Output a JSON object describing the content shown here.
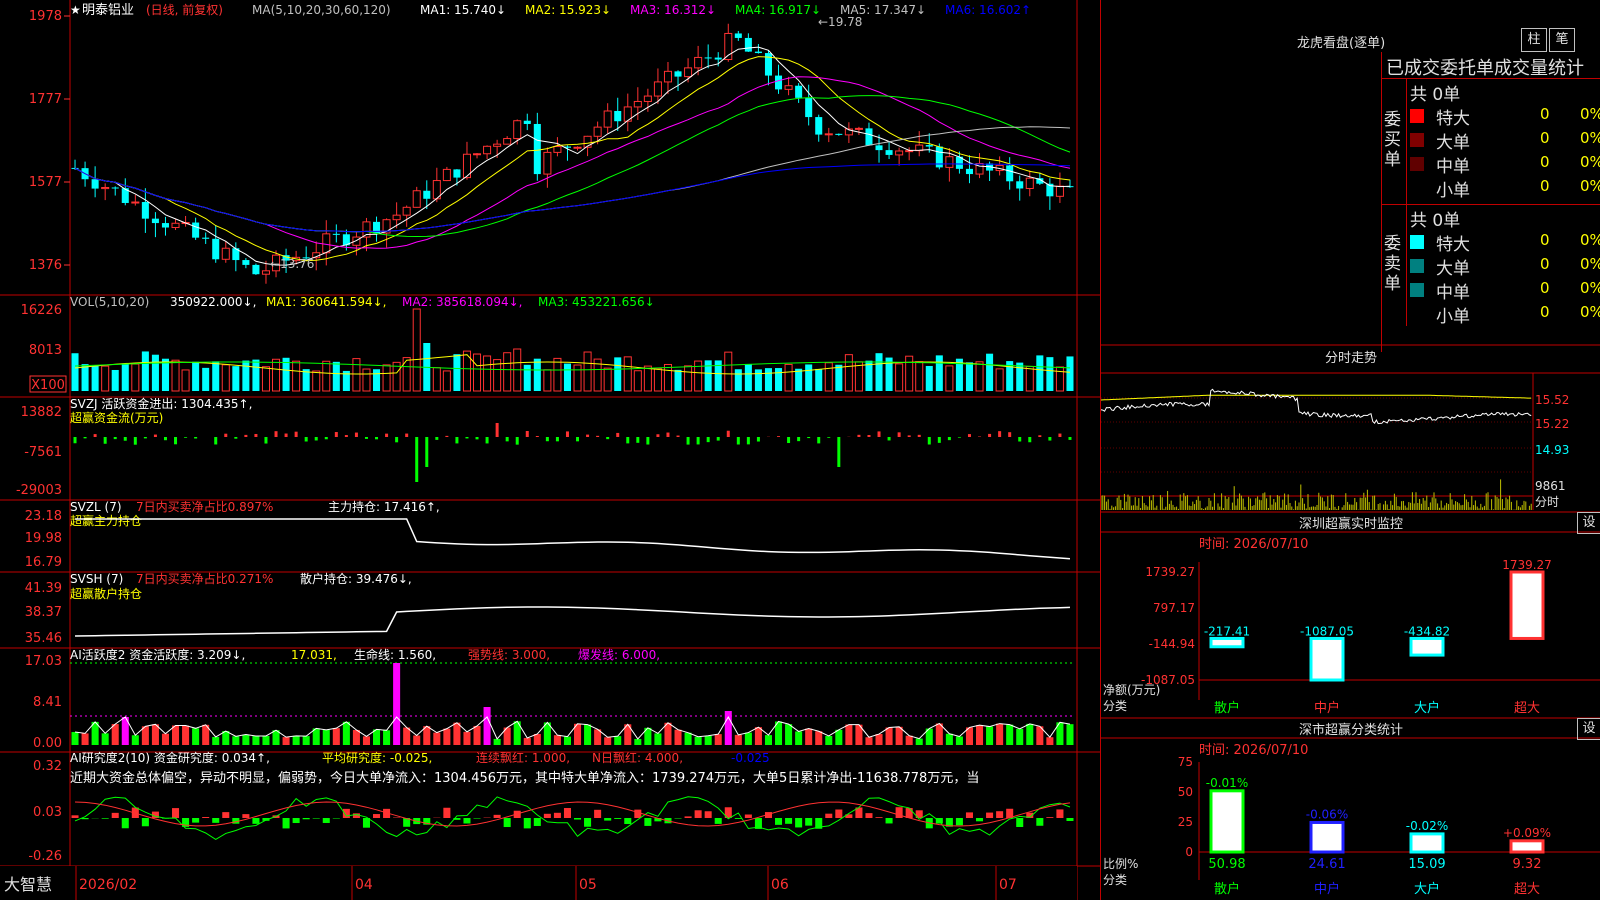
{
  "main": {
    "stock_name": "明泰铝业",
    "period": "(日线, 前复权)",
    "ma_params": "MA(5,10,20,30,60,120)",
    "ma": [
      {
        "label": "MA1:",
        "value": "15.740",
        "arrow": "↓",
        "color": "#ffffff"
      },
      {
        "label": "MA2:",
        "value": "15.923",
        "arrow": "↓",
        "color": "#ffff00"
      },
      {
        "label": "MA3:",
        "value": "16.312",
        "arrow": "↓",
        "color": "#ff00ff"
      },
      {
        "label": "MA4:",
        "value": "16.917",
        "arrow": "↓",
        "color": "#00ff00"
      },
      {
        "label": "MA5:",
        "value": "17.347",
        "arrow": "↓",
        "color": "#c0c0c0"
      },
      {
        "label": "MA6:",
        "value": "16.602",
        "arrow": "↑",
        "color": "#0000ff"
      }
    ],
    "y_ticks": [
      "1978",
      "1777",
      "1577",
      "1376"
    ],
    "hi_label": "19.78",
    "lo_label": "13.76"
  },
  "vol": {
    "label": "VOL(5,10,20)",
    "value": "350922.000",
    "ma1": "MA1: 360641.594",
    "ma2": "MA2: 385618.094",
    "ma3": "MA3: 453221.656",
    "y_ticks": [
      "16226",
      "8013",
      "X100"
    ]
  },
  "svzj": {
    "title": "SVZJ  活跃资金进出: 1304.435",
    "sub": "超赢资金流(万元)",
    "y_ticks": [
      "13882",
      "-7561",
      "-29003"
    ]
  },
  "svzl": {
    "title": "SVZL (7)",
    "ratio": "7日内买卖净占比0.897%",
    "hold": "主力持仓: 17.416",
    "sub": "超赢主力持仓",
    "y_ticks": [
      "23.18",
      "19.98",
      "16.79"
    ]
  },
  "svsh": {
    "title": "SVSH (7)",
    "ratio": "7日内买卖净占比0.271%",
    "hold": "散户持仓: 39.476",
    "sub": "超赢散户持仓",
    "y_ticks": [
      "41.39",
      "38.37",
      "35.46"
    ]
  },
  "ai2": {
    "title": "AI活跃度2 资金活跃度: 3.209",
    "v2": "17.031",
    "life": "生命线: 1.560",
    "strong": "强势线: 3.000",
    "burst": "爆发线: 6.000",
    "y_ticks": [
      "17.03",
      "8.41",
      "0.00"
    ]
  },
  "ai3": {
    "title": "AI研究度2(10) 资金研究度: 0.034",
    "avg": "平均研究度: -0.025",
    "red": "连续飘红: 1.000",
    "nred": "N日飘红: 4.000",
    "last": "-0.025",
    "comment": "近期大资金总体偏空，异动不明显，偏弱势，今日大单净流入：1304.456万元，其中特大单净流入：1739.274万元，大单5日累计净出-11638.778万元，当",
    "y_ticks": [
      "0.32",
      "0.03",
      "-0.26"
    ]
  },
  "x_axis": {
    "app_name": "大智慧",
    "labels": [
      "2026/02",
      "04",
      "05",
      "06",
      "07"
    ]
  },
  "right": {
    "title": "龙虎看盘(逐单)",
    "btn1": "柱",
    "btn2": "笔",
    "stat_header": "已成交委托单成交量统计",
    "buy_side": "委买单",
    "sell_side": "委卖单",
    "buy_total": "共 0单",
    "sell_total": "共 0单",
    "buy_rows": [
      {
        "label": "特大",
        "count": "0",
        "pct": "0%",
        "color": "#ff0000"
      },
      {
        "label": "大单",
        "count": "0",
        "pct": "0%",
        "color": "#800000"
      },
      {
        "label": "中单",
        "count": "0",
        "pct": "0%",
        "color": "#600000"
      },
      {
        "label": "小单",
        "count": "0",
        "pct": "0%",
        "color": "#000000"
      }
    ],
    "sell_rows": [
      {
        "label": "特大",
        "count": "0",
        "pct": "0%",
        "color": "#00ffff"
      },
      {
        "label": "大单",
        "count": "0",
        "pct": "0%",
        "color": "#008080"
      },
      {
        "label": "中单",
        "count": "0",
        "pct": "0%",
        "color": "#008080"
      },
      {
        "label": "小单",
        "count": "0",
        "pct": "0%",
        "color": "#000000"
      }
    ],
    "intraday_title": "分时走势",
    "intraday_prices": [
      "15.52",
      "15.22",
      "14.93"
    ],
    "intraday_vol": "9861",
    "intraday_vol_unit": "分时",
    "monitor_title": "深圳超赢实时监控",
    "set_label": "设",
    "time_label": "时间: 2026/07/10",
    "monitor_y": [
      "1739.27",
      "797.17",
      "-144.94",
      "-1087.05"
    ],
    "monitor_values": [
      "-217.41",
      "-1087.05",
      "-434.82",
      "1739.27"
    ],
    "monitor_ylabel": "净额(万元)",
    "category_label": "分类",
    "categories": [
      "散户",
      "中户",
      "大户",
      "超大"
    ],
    "class_title": "深市超赢分类统计",
    "class_y": [
      "75",
      "50",
      "25",
      "0"
    ],
    "class_pct": [
      "-0.01%",
      "-0.06%",
      "-0.02%",
      "+0.09%"
    ],
    "class_values": [
      "50.98",
      "24.61",
      "15.09",
      "9.32"
    ],
    "class_ylabel": "比例%"
  }
}
